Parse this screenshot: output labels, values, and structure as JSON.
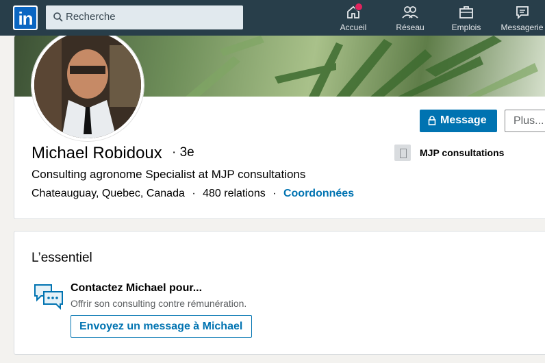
{
  "nav": {
    "logo_text": "in",
    "search_placeholder": "Recherche",
    "items": [
      {
        "label": "Accueil",
        "icon": "home-icon",
        "badge": true
      },
      {
        "label": "Réseau",
        "icon": "network-icon"
      },
      {
        "label": "Emplois",
        "icon": "briefcase-icon"
      },
      {
        "label": "Messagerie",
        "icon": "messaging-icon"
      }
    ],
    "colors": {
      "bar": "#283e4a",
      "brand": "#0a66c2",
      "badge": "#e0245e"
    }
  },
  "profile": {
    "name": "Michael Robidoux",
    "degree": "· 3e",
    "headline": "Consulting agronome Specialist at MJP consultations",
    "location": "Chateauguay, Quebec, Canada",
    "separator": "·",
    "relations": "480 relations",
    "contact_link": "Coordonnées",
    "message_button": "Message",
    "more_button": "Plus...",
    "company": "MJP consultations"
  },
  "essentiel": {
    "title": "L’essentiel",
    "contact_title": "Contactez Michael pour...",
    "contact_subtitle": "Offrir son consulting contre rémunération.",
    "contact_button": "Envoyez un message à Michael"
  },
  "colors": {
    "accent": "#0073b1",
    "page_bg": "#f3f2ef"
  }
}
